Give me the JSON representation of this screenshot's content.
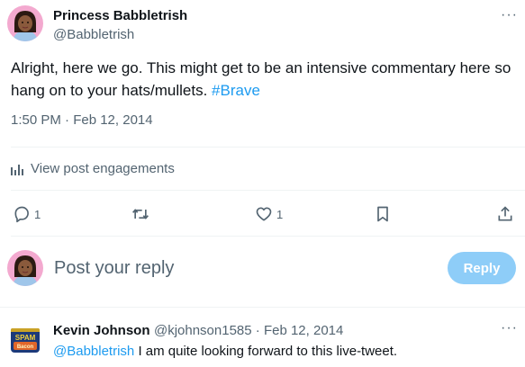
{
  "tweet": {
    "author_name": "Princess Babbletrish",
    "author_handle": "@Babbletrish",
    "more_label": "···",
    "text_before": "Alright, here we go. This might get to be an intensive commentary here so hang on to your hats/mullets.",
    "hashtag": "#Brave",
    "timestamp": "1:50 PM · Feb 12, 2014",
    "engagements_label": "View post engagements"
  },
  "actions": {
    "reply_count": "1",
    "retweet_count": "",
    "like_count": "1"
  },
  "compose": {
    "placeholder": "Post your reply",
    "button_label": "Reply"
  },
  "reply": {
    "author_name": "Kevin Johnson",
    "handle_date": "@kjohnson1585 · Feb 12, 2014",
    "mention": "@Babbletrish",
    "text": " I am quite looking forward to this live-tweet.",
    "more_label": "···",
    "avatar_text_top": "SPAM",
    "avatar_text_bottom": "Bacon"
  },
  "colors": {
    "accent": "#1d9bf0",
    "reply_button_disabled": "#8ecdf8",
    "muted": "#536471"
  }
}
